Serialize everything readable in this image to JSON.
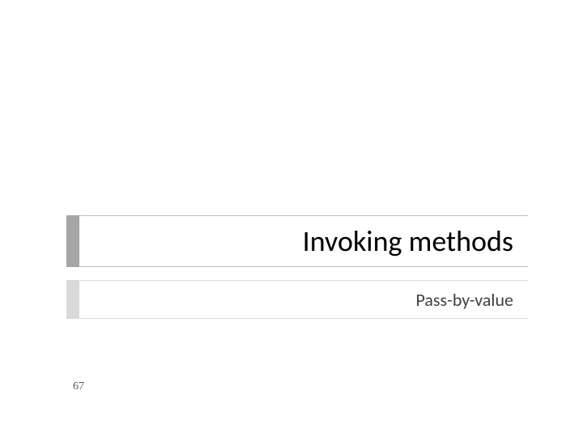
{
  "slide": {
    "title": "Invoking methods",
    "subtitle": "Pass-by-value",
    "page_number": "67"
  }
}
